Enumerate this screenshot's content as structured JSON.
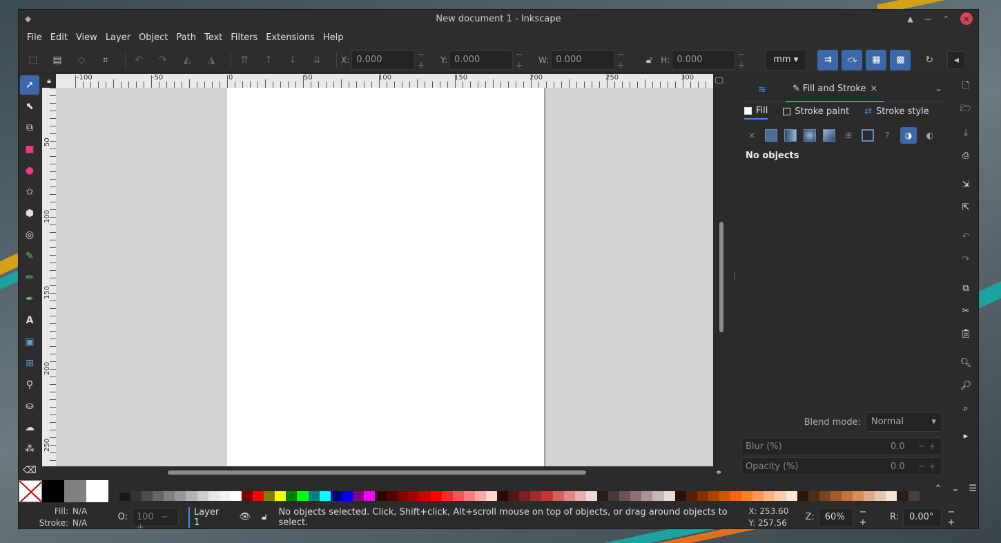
{
  "window": {
    "title": "New document 1 - Inkscape"
  },
  "menu": [
    "File",
    "Edit",
    "View",
    "Layer",
    "Object",
    "Path",
    "Text",
    "Filters",
    "Extensions",
    "Help"
  ],
  "toolbar": {
    "x_label": "X:",
    "x_value": "0.000",
    "y_label": "Y:",
    "y_value": "0.000",
    "w_label": "W:",
    "w_value": "0.000",
    "h_label": "H:",
    "h_value": "0.000",
    "pm": "−+",
    "unit": "mm"
  },
  "ruler": {
    "top_labels": [
      "-100",
      "-50",
      "0",
      "50",
      "100",
      "150",
      "200",
      "250",
      "300"
    ],
    "left_labels": [
      "50",
      "100",
      "150",
      "200",
      "250"
    ]
  },
  "panel": {
    "tab_label": "Fill and Stroke",
    "close": "×",
    "subtabs": {
      "fill": "Fill",
      "stroke_paint": "Stroke paint",
      "stroke_style": "Stroke style"
    },
    "message": "No objects",
    "blend_label": "Blend mode:",
    "blend_value": "Normal",
    "blur_label": "Blur (%)",
    "blur_value": "0.0",
    "opacity_label": "Opacity (%)",
    "opacity_value": "0.0"
  },
  "status": {
    "fill_label": "Fill:",
    "fill_value": "N/A",
    "stroke_label": "Stroke:",
    "stroke_value": "N/A",
    "opacity_label": "O:",
    "opacity_value": "100",
    "layer": "Layer 1",
    "message": "No objects selected. Click, Shift+click, Alt+scroll mouse on top of objects, or drag around objects to select.",
    "x_coord": "X:   253.60",
    "y_coord": "Y:   257.56",
    "zoom_label": "Z:",
    "zoom_value": "60%",
    "rotate_label": "R:",
    "rotate_value": "0.00°"
  },
  "palette_colors": [
    "#000000",
    "#808080",
    "#ffffff",
    "#1a1a1a",
    "#333333",
    "#4d4d4d",
    "#666666",
    "#808080",
    "#999999",
    "#b3b3b3",
    "#cccccc",
    "#e6e6e6",
    "#f2f2f2",
    "#ffffff",
    "#800000",
    "#ff0000",
    "#808000",
    "#ffff00",
    "#008000",
    "#00ff00",
    "#008080",
    "#00ffff",
    "#000080",
    "#0000ff",
    "#800080",
    "#ff00ff",
    "#2b0000",
    "#550000",
    "#800000",
    "#aa0000",
    "#d40000",
    "#ff0000",
    "#ff2a2a",
    "#ff5555",
    "#ff8080",
    "#ffaaaa",
    "#ffd5d5",
    "#280b0b",
    "#501616",
    "#782121",
    "#a02c2c",
    "#c83737",
    "#d35f5f",
    "#de8787",
    "#e9afaf",
    "#f4d7d7",
    "#241c1c",
    "#483737",
    "#6c5353",
    "#916f6f",
    "#ac9393",
    "#c8b7b7",
    "#e3dbdb",
    "#2b1100",
    "#552200",
    "#803300",
    "#aa4400",
    "#d45500",
    "#ff6600",
    "#ff7f2a",
    "#ff9955",
    "#ffb380",
    "#ffccaa",
    "#ffe6d5",
    "#28170b",
    "#502d16",
    "#784421",
    "#a05a2c",
    "#c87137",
    "#d38d5f",
    "#deaa87",
    "#e9c6af",
    "#f4e3d7",
    "#241f1c",
    "#483e37"
  ]
}
